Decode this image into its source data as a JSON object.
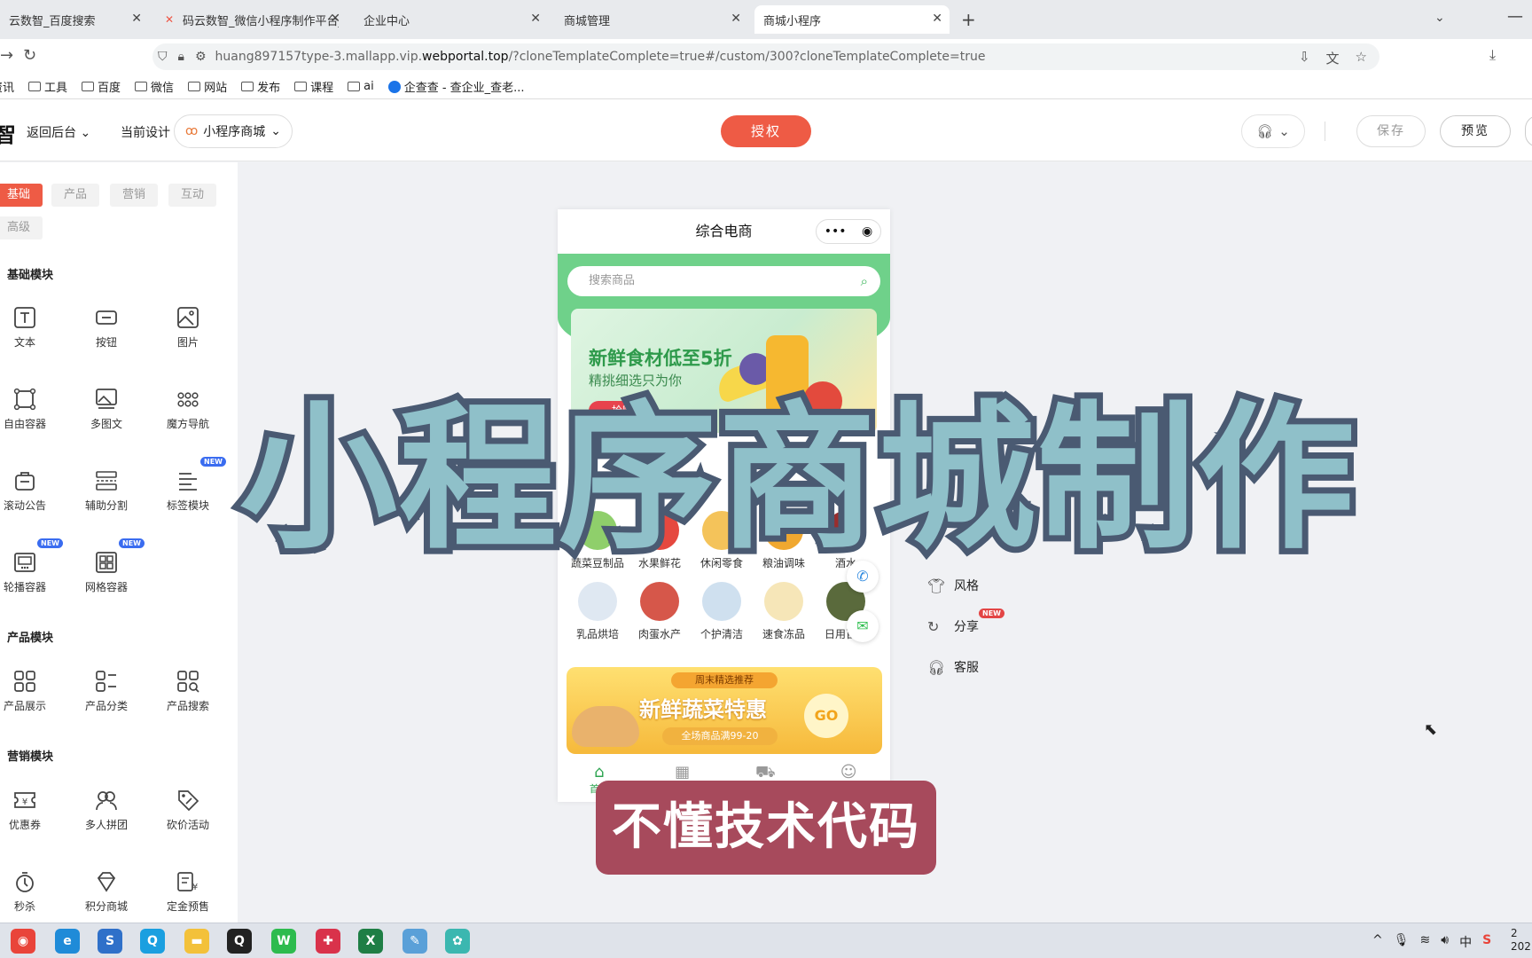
{
  "browser": {
    "tabs": [
      {
        "label": "云数智_百度搜索"
      },
      {
        "label": "码云数智_微信小程序制作平台_"
      },
      {
        "label": "企业中心"
      },
      {
        "label": "商城管理"
      },
      {
        "label": "商城小程序"
      }
    ],
    "url_prefix": "huang897157type-3.mallapp.vip.",
    "url_domain": "webportal.top",
    "url_suffix": "/?cloneTemplateComplete=true#/custom/300?cloneTemplateComplete=true",
    "bookmarks": [
      "资讯",
      "工具",
      "百度",
      "微信",
      "网站",
      "发布",
      "课程",
      "ai",
      "企查查 - 查企业_查老..."
    ]
  },
  "header": {
    "logo": "智",
    "back_label": "返回后台",
    "current_design_label": "当前设计",
    "design_select_value": "小程序商城",
    "auth_label": "授权",
    "save_label": "保存",
    "preview_label": "预览"
  },
  "left_panel": {
    "tabs": [
      "基础",
      "产品",
      "营销",
      "互动",
      "高级"
    ],
    "sections": [
      {
        "title": "基础模块",
        "items": [
          "文本",
          "按钮",
          "图片",
          "自由容器",
          "多图文",
          "魔方导航",
          "滚动公告",
          "辅助分割",
          "标签模块",
          "轮播容器",
          "网格容器"
        ]
      },
      {
        "title": "产品模块",
        "items": [
          "产品展示",
          "产品分类",
          "产品搜索"
        ]
      },
      {
        "title": "营销模块",
        "items": [
          "优惠券",
          "多人拼团",
          "砍价活动",
          "秒杀",
          "积分商城",
          "定金预售"
        ]
      }
    ],
    "new_badge": "NEW"
  },
  "phone": {
    "title": "综合电商",
    "capsule_more": "•••",
    "capsule_close": "◉",
    "search_placeholder": "搜索商品",
    "banner_title": "新鲜食材低至5折",
    "banner_sub": "精挑细选只为你",
    "banner_btn": "抢购",
    "categories_row1": [
      "蔬菜豆制品",
      "水果鲜花",
      "休闲零食",
      "粮油调味",
      "酒水"
    ],
    "categories_row2": [
      "乳品烘培",
      "肉蛋水产",
      "个护清洁",
      "速食冻品",
      "日用百货"
    ],
    "promo_tag": "周末精选推荐",
    "promo_title": "新鲜蔬菜特惠",
    "promo_sub": "全场商品满99-20",
    "promo_go": "GO",
    "nav_home_label": "首页"
  },
  "right_menu": {
    "items": [
      "风格",
      "分享",
      "客服"
    ],
    "new_badge": "NEW"
  },
  "overlay": {
    "big_title": "小程序商城制作",
    "caption": "不懂技术代码"
  },
  "taskbar": {
    "tray_lang": "中",
    "clock_time": "2",
    "clock_date": "202"
  },
  "colors": {
    "accent": "#ee5b45",
    "phone_green": "#6fd18a",
    "title_fill": "#8fc0c9",
    "title_stroke": "#4a5a72",
    "caption_bg": "#a74a5c"
  }
}
